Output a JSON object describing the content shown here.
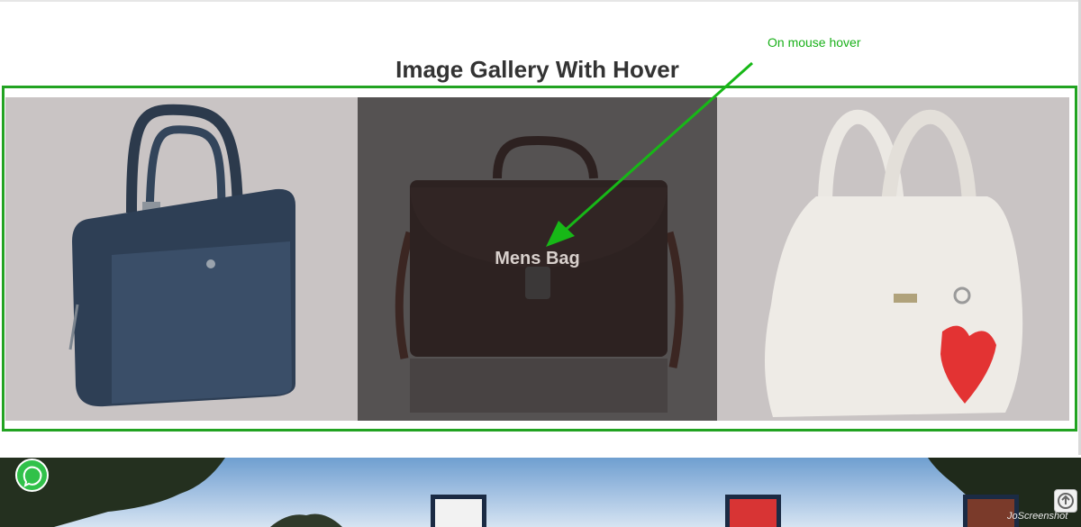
{
  "annotation": {
    "text": "On mouse hover",
    "color": "#19b019"
  },
  "gallery": {
    "title": "Image Gallery With Hover",
    "frame_color": "#22a322",
    "items": [
      {
        "icon": "laptop-briefcase-icon",
        "caption": ""
      },
      {
        "icon": "mens-bag-icon",
        "caption": "Mens Bag",
        "hovered": true
      },
      {
        "icon": "white-handbag-icon",
        "caption": ""
      }
    ]
  },
  "floating": {
    "whatsapp_icon": "whatsapp-icon",
    "scroll_top_icon": "scroll-to-top-icon",
    "watermark": "JoScreenshot"
  }
}
